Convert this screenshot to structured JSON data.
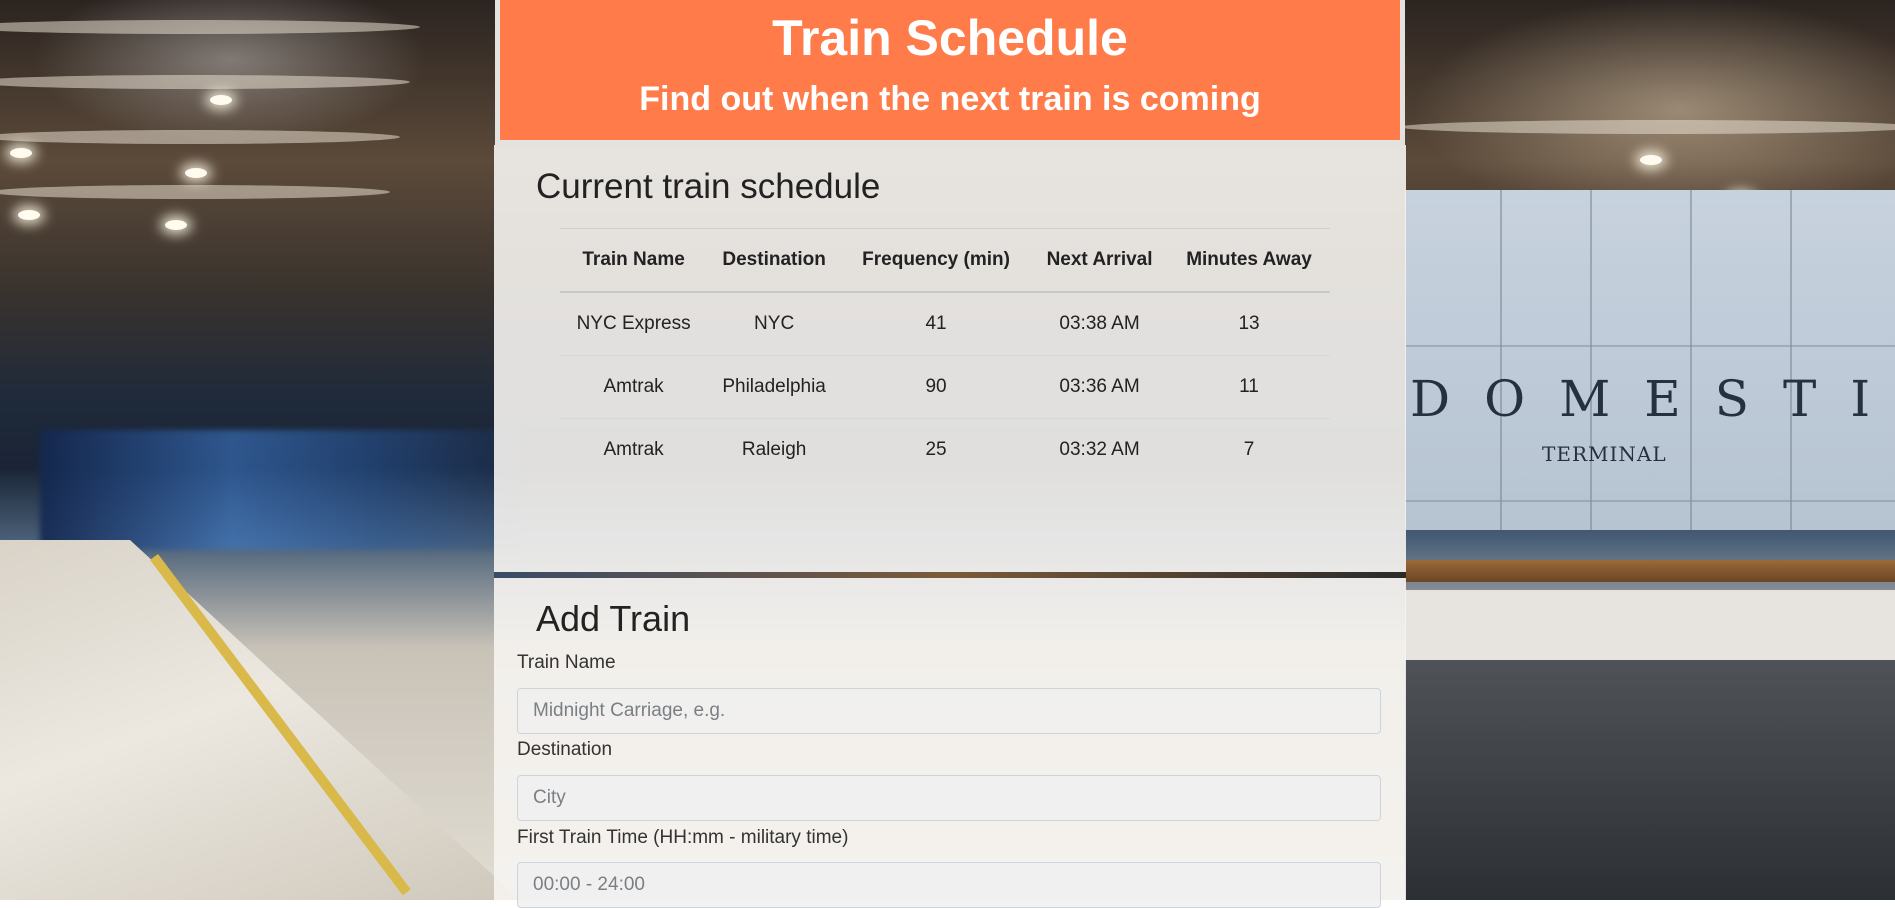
{
  "header": {
    "title": "Train Schedule",
    "subtitle": "Find out when the next train is coming"
  },
  "schedule": {
    "heading": "Current train schedule",
    "columns": [
      "Train Name",
      "Destination",
      "Frequency (min)",
      "Next Arrival",
      "Minutes Away"
    ],
    "rows": [
      [
        "NYC Express",
        "NYC",
        "41",
        "03:38 AM",
        "13"
      ],
      [
        "Amtrak",
        "Philadelphia",
        "90",
        "03:36 AM",
        "11"
      ],
      [
        "Amtrak",
        "Raleigh",
        "25",
        "03:32 AM",
        "7"
      ]
    ]
  },
  "add_train": {
    "heading": "Add Train",
    "fields": [
      {
        "label": "Train Name",
        "placeholder": "Midnight Carriage, e.g."
      },
      {
        "label": "Destination",
        "placeholder": "City"
      },
      {
        "label": "First Train Time (HH:mm - military time)",
        "placeholder": "00:00 - 24:00"
      }
    ]
  },
  "background": {
    "sign_main": "DOMESTIC",
    "sign_sub": "TERMINAL"
  },
  "colors": {
    "header_bg": "#ff7b4a",
    "header_text": "#ffffff"
  }
}
